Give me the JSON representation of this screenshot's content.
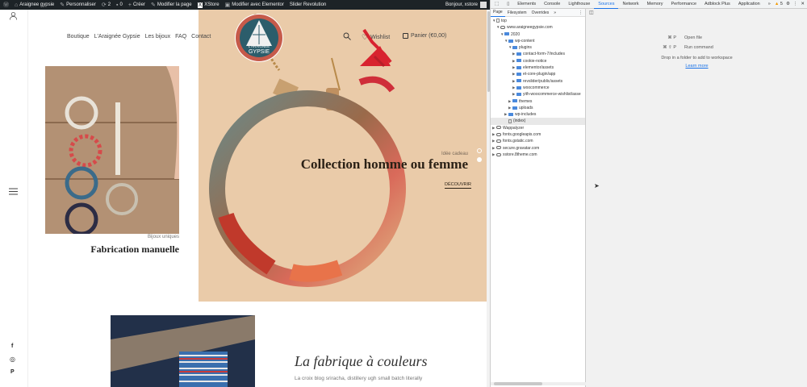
{
  "admin_bar": {
    "site_name": "Araignee gypsie",
    "customize": "Personnaliser",
    "updates": "2",
    "comments": "0",
    "new": "Créer",
    "edit_page": "Modifier la page",
    "xstore": "XStore",
    "elementor": "Modifier avec Elementor",
    "slider": "Slider Revolution",
    "greeting": "Bonjour, xstore"
  },
  "site": {
    "nav": [
      "Boutique",
      "L'Araignée Gypsie",
      "Les bijoux",
      "FAQ",
      "Contact"
    ],
    "logo_text": [
      "L'ARAIGNÉE",
      "GYPSIE"
    ],
    "wishlist": "Wishlist",
    "cart": "Panier (€0,00)",
    "card_caption": "Bijoux uniques",
    "card_title": "Fabrication manuelle",
    "hero_kicker": "Idée cadeau",
    "hero_title": "Collection homme ou femme",
    "hero_cta": "DÉCOUVRIR",
    "section_title": "La fabrique à couleurs",
    "section_text": "La croix blog sriracha, distillery ugh small batch literally",
    "social": [
      "f",
      "◎",
      "P"
    ]
  },
  "devtools": {
    "tabs": [
      "Elements",
      "Console",
      "Lighthouse",
      "Sources",
      "Network",
      "Memory",
      "Performance",
      "Adblock Plus",
      "Application"
    ],
    "active_tab": "Sources",
    "badge": "5",
    "subtabs": [
      "Page",
      "Filesystem",
      "Overrides"
    ],
    "tree": [
      {
        "label": "top",
        "level": 0,
        "icon": "file",
        "open": true
      },
      {
        "label": "www.araigneegypsie.com",
        "level": 1,
        "icon": "cloud",
        "open": true
      },
      {
        "label": "2020",
        "level": 2,
        "icon": "folder",
        "open": true
      },
      {
        "label": "wp-content",
        "level": 3,
        "icon": "folder",
        "open": true
      },
      {
        "label": "plugins",
        "level": 4,
        "icon": "folder",
        "open": true
      },
      {
        "label": "contact-form-7/includes",
        "level": 5,
        "icon": "folder",
        "open": false
      },
      {
        "label": "cookie-notice",
        "level": 5,
        "icon": "folder",
        "open": false
      },
      {
        "label": "elementor/assets",
        "level": 5,
        "icon": "folder",
        "open": false
      },
      {
        "label": "et-core-plugin/app",
        "level": 5,
        "icon": "folder",
        "open": false
      },
      {
        "label": "revslider/public/assets",
        "level": 5,
        "icon": "folder",
        "open": false
      },
      {
        "label": "woocommerce",
        "level": 5,
        "icon": "folder",
        "open": false
      },
      {
        "label": "yith-woocommerce-wishlist/asse",
        "level": 5,
        "icon": "folder",
        "open": false
      },
      {
        "label": "themes",
        "level": 4,
        "icon": "folder",
        "open": false
      },
      {
        "label": "uploads",
        "level": 4,
        "icon": "folder",
        "open": false
      },
      {
        "label": "wp-includes",
        "level": 3,
        "icon": "folder",
        "open": false
      },
      {
        "label": "(index)",
        "level": 3,
        "icon": "file",
        "open": null,
        "selected": true
      },
      {
        "label": "Wappalyzer",
        "level": 0,
        "icon": "cloud",
        "open": false
      },
      {
        "label": "fonts.googleapis.com",
        "level": 0,
        "icon": "cloud",
        "open": false
      },
      {
        "label": "fonts.gstatic.com",
        "level": 0,
        "icon": "cloud",
        "open": false
      },
      {
        "label": "secure.gravatar.com",
        "level": 0,
        "icon": "cloud",
        "open": false
      },
      {
        "label": "xstore.8theme.com",
        "level": 0,
        "icon": "cloud",
        "open": false
      }
    ],
    "shortcuts": [
      {
        "keys": "⌘ P",
        "label": "Open file"
      },
      {
        "keys": "⌘ ⇧ P",
        "label": "Run command"
      }
    ],
    "drop_hint": "Drop in a folder to add to workspace",
    "learn_more": "Learn more"
  },
  "colors": {
    "hero_bg": "#eacba9",
    "admin_bar": "#1d2327",
    "devtools_accent": "#1a73e8"
  }
}
